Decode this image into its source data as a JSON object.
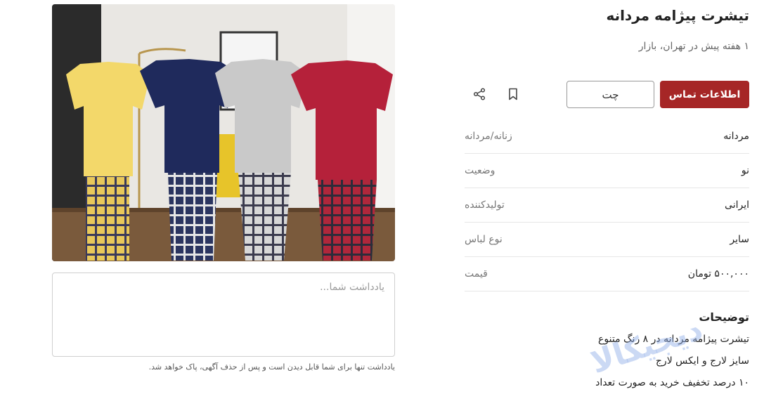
{
  "listing": {
    "title": "تیشرت پیژامه مردانه",
    "subtitle": "۱ هفته پیش در تهران، بازار"
  },
  "actions": {
    "contact_label": "اطلاعات تماس",
    "chat_label": "چت",
    "bookmark_icon": "bookmark-icon",
    "share_icon": "share-icon",
    "primary_color": "#a62626"
  },
  "attributes": [
    {
      "key": "زنانه/مردانه",
      "value": "مردانه"
    },
    {
      "key": "وضعیت",
      "value": "نو"
    },
    {
      "key": "تولیدکننده",
      "value": "ایرانی"
    },
    {
      "key": "نوع لباس",
      "value": "سایر"
    },
    {
      "key": "قیمت",
      "value": "۵۰۰,۰۰۰ تومان"
    }
  ],
  "description": {
    "title": "توضیحات",
    "lines": [
      "تیشرت پیژامه مردانه در ۸ رنگ متنوع",
      "سایز لارج و ایکس لارج",
      "۱۰ درصد تخفیف خرید به صورت تعداد"
    ]
  },
  "note": {
    "placeholder": "یادداشت شما...",
    "value": "",
    "hint": "یادداشت تنها برای شما قابل دیدن است و پس از حذف آگهی، پاک خواهد شد."
  },
  "image": {
    "shirt_colors": [
      "#f3d86a",
      "#1f2a5c",
      "#c9c9c9",
      "#b5213a"
    ]
  },
  "watermark": {
    "text": "دیجیکالا"
  }
}
